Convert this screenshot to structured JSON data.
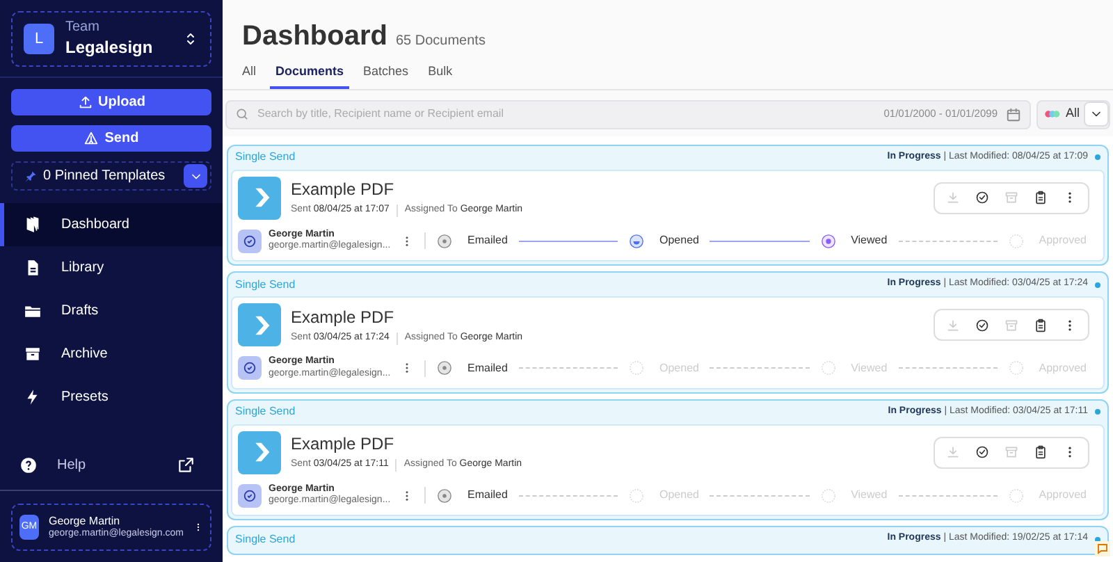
{
  "sidebar": {
    "team": {
      "avatar": "L",
      "label": "Team",
      "name": "Legalesign"
    },
    "buttons": [
      {
        "kind": "upload",
        "label": "Upload"
      },
      {
        "kind": "send",
        "label": "Send"
      }
    ],
    "pinned": {
      "label": "0 Pinned Templates"
    },
    "nav": [
      {
        "kind": "dashboard",
        "label": "Dashboard",
        "selected": true
      },
      {
        "kind": "library",
        "label": "Library",
        "selected": false
      },
      {
        "kind": "drafts",
        "label": "Drafts",
        "selected": false
      },
      {
        "kind": "archive",
        "label": "Archive",
        "selected": false
      },
      {
        "kind": "presets",
        "label": "Presets",
        "selected": false
      }
    ],
    "help": {
      "label": "Help"
    },
    "user": {
      "initials": "GM",
      "name": "George Martin",
      "email": "george.martin@legalesign.com"
    }
  },
  "header": {
    "title": "Dashboard",
    "count": "65 Documents"
  },
  "tabs": [
    {
      "label": "All",
      "selected": false
    },
    {
      "label": "Documents",
      "selected": true
    },
    {
      "label": "Batches",
      "selected": false
    },
    {
      "label": "Bulk",
      "selected": false
    }
  ],
  "search": {
    "placeholder": "Search by title, Recipient name or Recipient email",
    "date_range": "01/01/2000 - 01/01/2099",
    "filter": "All"
  },
  "documents": [
    {
      "type": "Single Send",
      "status": "**In Progress** | Last Modified: 08/04/25 at 17:09",
      "title": "Example PDF",
      "sent": "Sent **08/04/25 at 17:07**",
      "assigned": "Assigned To **George Martin**",
      "recipient": {
        "name": "George Martin",
        "email": "george.martin@legalesign..."
      },
      "steps": [
        {
          "kind": "emailed",
          "label": "Emailed",
          "done": true
        },
        {
          "kind": "opened",
          "label": "Opened",
          "done": true
        },
        {
          "kind": "viewed",
          "label": "Viewed",
          "done": true
        },
        {
          "kind": "approved",
          "label": "Approved",
          "done": false
        }
      ]
    },
    {
      "type": "Single Send",
      "status": "**In Progress** | Last Modified: 03/04/25 at 17:24",
      "title": "Example PDF",
      "sent": "Sent **03/04/25 at 17:24**",
      "assigned": "Assigned To **George Martin**",
      "recipient": {
        "name": "George Martin",
        "email": "george.martin@legalesign..."
      },
      "steps": [
        {
          "kind": "emailed",
          "label": "Emailed",
          "done": true
        },
        {
          "kind": "opened",
          "label": "Opened",
          "done": false
        },
        {
          "kind": "viewed",
          "label": "Viewed",
          "done": false
        },
        {
          "kind": "approved",
          "label": "Approved",
          "done": false
        }
      ]
    },
    {
      "type": "Single Send",
      "status": "**In Progress** | Last Modified: 03/04/25 at 17:11",
      "title": "Example PDF",
      "sent": "Sent **03/04/25 at 17:11**",
      "assigned": "Assigned To **George Martin**",
      "recipient": {
        "name": "George Martin",
        "email": "george.martin@legalesign..."
      },
      "steps": [
        {
          "kind": "emailed",
          "label": "Emailed",
          "done": true
        },
        {
          "kind": "opened",
          "label": "Opened",
          "done": false
        },
        {
          "kind": "viewed",
          "label": "Viewed",
          "done": false
        },
        {
          "kind": "approved",
          "label": "Approved",
          "done": false
        }
      ]
    },
    {
      "type": "Single Send",
      "status": "**In Progress** | Last Modified: 19/02/25 at 17:14"
    }
  ]
}
